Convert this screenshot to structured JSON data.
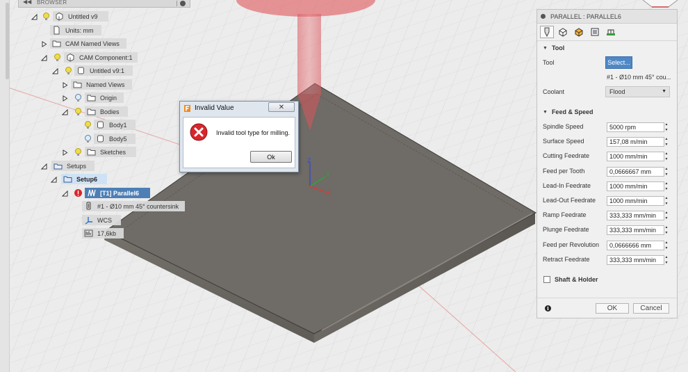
{
  "colors": {
    "accent": "#4d7fb5",
    "setup_highlight": "#cfe2f5",
    "select_button": "#4e88c7",
    "error_red": "#d8262b",
    "tool_red": "#e0484f",
    "stock_top": "#6e6a65",
    "grid": "#d2d2d2",
    "bulb": "#f0dc4a"
  },
  "browser": {
    "title": "BROWSER",
    "items": [
      {
        "label": "Untitled v9",
        "icon": "component-icon"
      },
      {
        "label": "Units: mm",
        "icon": "document-icon"
      },
      {
        "label": "CAM Named Views",
        "icon": "folder-icon"
      },
      {
        "label": "CAM Component:1",
        "icon": "component-icon"
      },
      {
        "label": "Untitled v9:1",
        "icon": "body-icon"
      },
      {
        "label": "Named Views",
        "icon": "folder-icon"
      },
      {
        "label": "Origin",
        "icon": "folder-icon"
      },
      {
        "label": "Bodies",
        "icon": "folder-icon"
      },
      {
        "label": "Body1",
        "icon": "body-icon"
      },
      {
        "label": "Body5",
        "icon": "body-icon"
      },
      {
        "label": "Sketches",
        "icon": "folder-icon"
      },
      {
        "label": "Setups",
        "icon": "setups-icon"
      },
      {
        "label": "Setup6",
        "icon": "setup-icon"
      },
      {
        "label": "[T1] Parallel6",
        "icon": "parallel-toolpath-icon"
      },
      {
        "label": "#1 - Ø10 mm 45° countersink",
        "icon": "tool-icon"
      },
      {
        "label": "WCS",
        "icon": "wcs-icon"
      },
      {
        "label": "17,6kb",
        "icon": "nc-data-icon"
      }
    ]
  },
  "dialog": {
    "title": "Invalid Value",
    "message": "Invalid tool type for milling.",
    "ok_label": "Ok"
  },
  "viewport": {
    "axes": {
      "x": "X",
      "y": "Y",
      "z": "Z"
    }
  },
  "panel": {
    "title": "PARALLEL : PARALLEL6",
    "tabs": [
      "tool-tab-icon",
      "geometry-tab-icon",
      "heights-tab-icon",
      "passes-tab-icon",
      "linking-tab-icon"
    ],
    "tool_section": "Tool",
    "tool_label": "Tool",
    "select_label": "Select...",
    "tool_name": "#1 - Ø10 mm 45° cou...",
    "coolant_label": "Coolant",
    "coolant_value": "Flood",
    "feed_section": "Feed & Speed",
    "fields": [
      {
        "label": "Spindle Speed",
        "value": "5000 rpm"
      },
      {
        "label": "Surface Speed",
        "value": "157,08 m/min"
      },
      {
        "label": "Cutting Feedrate",
        "value": "1000 mm/min"
      },
      {
        "label": "Feed per Tooth",
        "value": "0,0666667 mm"
      },
      {
        "label": "Lead-In Feedrate",
        "value": "1000 mm/min"
      },
      {
        "label": "Lead-Out Feedrate",
        "value": "1000 mm/min"
      },
      {
        "label": "Ramp Feedrate",
        "value": "333,333 mm/min"
      },
      {
        "label": "Plunge Feedrate",
        "value": "333,333 mm/min"
      },
      {
        "label": "Feed per Revolution",
        "value": "0,0666666 mm"
      },
      {
        "label": "Retract Feedrate",
        "value": "333,333 mm/min"
      }
    ],
    "shaft_section": "Shaft & Holder",
    "info_glyph": "i",
    "ok_label": "OK",
    "cancel_label": "Cancel"
  }
}
